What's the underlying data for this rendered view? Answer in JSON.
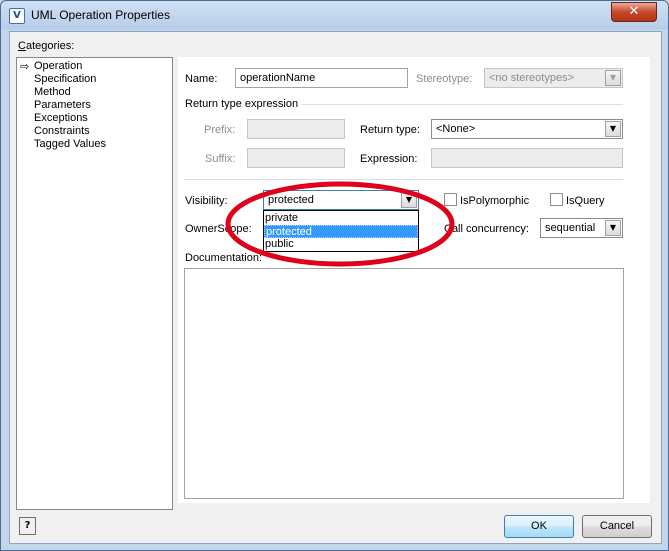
{
  "window": {
    "title": "UML Operation Properties",
    "icon_text": "V",
    "close_glyph": "✕"
  },
  "categories": {
    "label_prefix": "C",
    "label_rest": "ategories:",
    "items": [
      "Operation",
      "Specification",
      "Method",
      "Parameters",
      "Exceptions",
      "Constraints",
      "Tagged Values"
    ],
    "selected_index": 0
  },
  "form": {
    "name_label": "Name:",
    "name_value": "operationName",
    "stereotype_label": "Stereotype:",
    "stereotype_value": "<no stereotypes>",
    "return_group_label": "Return type expression",
    "prefix_label": "Prefix:",
    "prefix_value": "",
    "suffix_label": "Suffix:",
    "suffix_value": "",
    "return_type_label": "Return type:",
    "return_type_value": "<None>",
    "expression_label": "Expression:",
    "expression_value": "",
    "visibility_label": "Visibility:",
    "visibility_value": "protected",
    "visibility_options": [
      "private",
      "protected",
      "public"
    ],
    "visibility_selected_index": 1,
    "is_polymorphic_label": "IsPolymorphic",
    "is_polymorphic_checked": false,
    "is_query_label": "IsQuery",
    "is_query_checked": false,
    "owner_scope_label": "OwnerScope:",
    "call_concurrency_label": "Call concurrency:",
    "call_concurrency_value": "sequential",
    "documentation_label": "Documentation:",
    "documentation_value": ""
  },
  "buttons": {
    "ok": "OK",
    "cancel": "Cancel",
    "help": "?"
  },
  "colors": {
    "selection": "#3399ff",
    "annotation_circle": "#e0001b",
    "titlebar": "#b7cde8",
    "close_button": "#c7482b"
  },
  "icons": {
    "category_pointer": "⇨",
    "dropdown_arrow": "▼"
  }
}
